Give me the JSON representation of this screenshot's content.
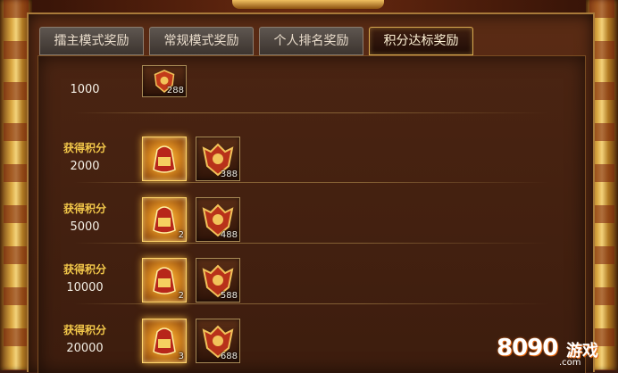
{
  "tabs": [
    {
      "label": "擂主模式奖励",
      "active": false
    },
    {
      "label": "常规模式奖励",
      "active": false
    },
    {
      "label": "个人排名奖励",
      "active": false
    },
    {
      "label": "积分达标奖励",
      "active": true
    }
  ],
  "rows": [
    {
      "title": "",
      "value": "1000",
      "items": [
        {
          "icon": "shield-badge-icon",
          "glow": false,
          "count": "288"
        }
      ]
    },
    {
      "title": "获得积分",
      "value": "2000",
      "items": [
        {
          "icon": "treasure-bag-icon",
          "glow": true,
          "count": ""
        },
        {
          "icon": "shield-badge-icon",
          "glow": false,
          "count": "388"
        }
      ]
    },
    {
      "title": "获得积分",
      "value": "5000",
      "items": [
        {
          "icon": "treasure-bag-icon",
          "glow": true,
          "count": "2"
        },
        {
          "icon": "shield-badge-icon",
          "glow": false,
          "count": "488"
        }
      ]
    },
    {
      "title": "获得积分",
      "value": "10000",
      "items": [
        {
          "icon": "treasure-bag-icon",
          "glow": true,
          "count": "2"
        },
        {
          "icon": "shield-badge-icon",
          "glow": false,
          "count": "588"
        }
      ]
    },
    {
      "title": "获得积分",
      "value": "20000",
      "items": [
        {
          "icon": "treasure-bag-icon",
          "glow": true,
          "count": "3"
        },
        {
          "icon": "shield-badge-icon",
          "glow": false,
          "count": "688"
        }
      ]
    }
  ],
  "watermark": {
    "number": "8090",
    "text": "游戏",
    "sub": ".com"
  },
  "colors": {
    "accent_gold": "#f3c84a",
    "panel": "#4a2412",
    "active_tab_border": "#d7a94f"
  }
}
